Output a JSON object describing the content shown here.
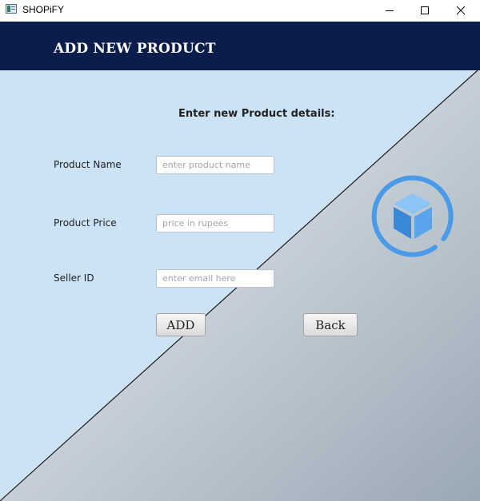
{
  "window": {
    "title": "SHOPiFY",
    "controls": [
      "minimize-icon",
      "maximize-icon",
      "close-icon"
    ]
  },
  "header": {
    "title": "ADD NEW PRODUCT"
  },
  "form": {
    "heading": "Enter new Product details:",
    "fields": [
      {
        "label": "Product Name",
        "placeholder": "enter product name",
        "value": ""
      },
      {
        "label": "Product Price",
        "placeholder": "price in rupees",
        "value": ""
      },
      {
        "label": "Seller ID",
        "placeholder": "enter email here",
        "value": ""
      }
    ],
    "add_label": "ADD",
    "back_label": "Back"
  },
  "logo": {
    "icon": "cube-icon",
    "color": "#4a9ae8"
  },
  "colors": {
    "header_bg": "#0b1d4b",
    "panel_light_blue": "#cce2f5",
    "gradient_start": "#f2f6f9",
    "gradient_end": "#9aa8b5"
  }
}
